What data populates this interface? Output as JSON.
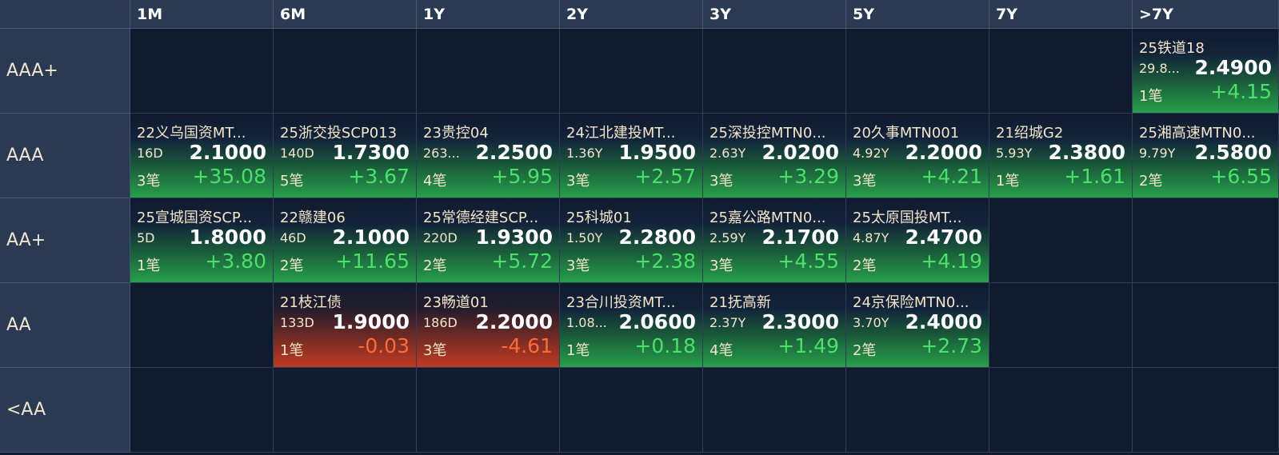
{
  "columns": [
    "1M",
    "6M",
    "1Y",
    "2Y",
    "3Y",
    "5Y",
    "7Y",
    ">7Y"
  ],
  "rows": [
    "AAA+",
    "AAA",
    "AA+",
    "AA",
    "<AA"
  ],
  "colors": {
    "up": "#4be06a",
    "down": "#ff6a3a",
    "header_bg": "#2a3a52",
    "bg": "#0f1b2f"
  },
  "cells": [
    {
      "row": 0,
      "col": 7,
      "name": "25铁道18",
      "term": "29.8...",
      "yield": "2.4900",
      "count": "1笔",
      "change": "+4.15",
      "dir": "up"
    },
    {
      "row": 1,
      "col": 0,
      "name": "22义乌国资MT...",
      "term": "16D",
      "yield": "2.1000",
      "count": "3笔",
      "change": "+35.08",
      "dir": "up"
    },
    {
      "row": 1,
      "col": 1,
      "name": "25浙交投SCP013",
      "term": "140D",
      "yield": "1.7300",
      "count": "5笔",
      "change": "+3.67",
      "dir": "up"
    },
    {
      "row": 1,
      "col": 2,
      "name": "23贵控04",
      "term": "263...",
      "yield": "2.2500",
      "count": "4笔",
      "change": "+5.95",
      "dir": "up"
    },
    {
      "row": 1,
      "col": 3,
      "name": "24江北建投MT...",
      "term": "1.36Y",
      "yield": "1.9500",
      "count": "3笔",
      "change": "+2.57",
      "dir": "up"
    },
    {
      "row": 1,
      "col": 4,
      "name": "25深投控MTN0...",
      "term": "2.63Y",
      "yield": "2.0200",
      "count": "3笔",
      "change": "+3.29",
      "dir": "up"
    },
    {
      "row": 1,
      "col": 5,
      "name": "20久事MTN001",
      "term": "4.92Y",
      "yield": "2.2000",
      "count": "3笔",
      "change": "+4.21",
      "dir": "up"
    },
    {
      "row": 1,
      "col": 6,
      "name": "21绍城G2",
      "term": "5.93Y",
      "yield": "2.3800",
      "count": "1笔",
      "change": "+1.61",
      "dir": "up"
    },
    {
      "row": 1,
      "col": 7,
      "name": "25湘高速MTN0...",
      "term": "9.79Y",
      "yield": "2.5800",
      "count": "2笔",
      "change": "+6.55",
      "dir": "up"
    },
    {
      "row": 2,
      "col": 0,
      "name": "25宣城国资SCP...",
      "term": "5D",
      "yield": "1.8000",
      "count": "1笔",
      "change": "+3.80",
      "dir": "up"
    },
    {
      "row": 2,
      "col": 1,
      "name": "22赣建06",
      "term": "46D",
      "yield": "2.1000",
      "count": "2笔",
      "change": "+11.65",
      "dir": "up"
    },
    {
      "row": 2,
      "col": 2,
      "name": "25常德经建SCP...",
      "term": "220D",
      "yield": "1.9300",
      "count": "2笔",
      "change": "+5.72",
      "dir": "up"
    },
    {
      "row": 2,
      "col": 3,
      "name": "25科城01",
      "term": "1.50Y",
      "yield": "2.2800",
      "count": "3笔",
      "change": "+2.38",
      "dir": "up"
    },
    {
      "row": 2,
      "col": 4,
      "name": "25嘉公路MTN0...",
      "term": "2.59Y",
      "yield": "2.1700",
      "count": "3笔",
      "change": "+4.55",
      "dir": "up"
    },
    {
      "row": 2,
      "col": 5,
      "name": "25太原国投MT...",
      "term": "4.87Y",
      "yield": "2.4700",
      "count": "2笔",
      "change": "+4.19",
      "dir": "up"
    },
    {
      "row": 3,
      "col": 1,
      "name": "21枝江债",
      "term": "133D",
      "yield": "1.9000",
      "count": "1笔",
      "change": "-0.03",
      "dir": "down"
    },
    {
      "row": 3,
      "col": 2,
      "name": "23畅道01",
      "term": "186D",
      "yield": "2.2000",
      "count": "3笔",
      "change": "-4.61",
      "dir": "down"
    },
    {
      "row": 3,
      "col": 3,
      "name": "23合川投资MT...",
      "term": "1.08...",
      "yield": "2.0600",
      "count": "1笔",
      "change": "+0.18",
      "dir": "up"
    },
    {
      "row": 3,
      "col": 4,
      "name": "21抚高新",
      "term": "2.37Y",
      "yield": "2.3000",
      "count": "4笔",
      "change": "+1.49",
      "dir": "up"
    },
    {
      "row": 3,
      "col": 5,
      "name": "24京保险MTN0...",
      "term": "3.70Y",
      "yield": "2.4000",
      "count": "2笔",
      "change": "+2.73",
      "dir": "up"
    }
  ]
}
